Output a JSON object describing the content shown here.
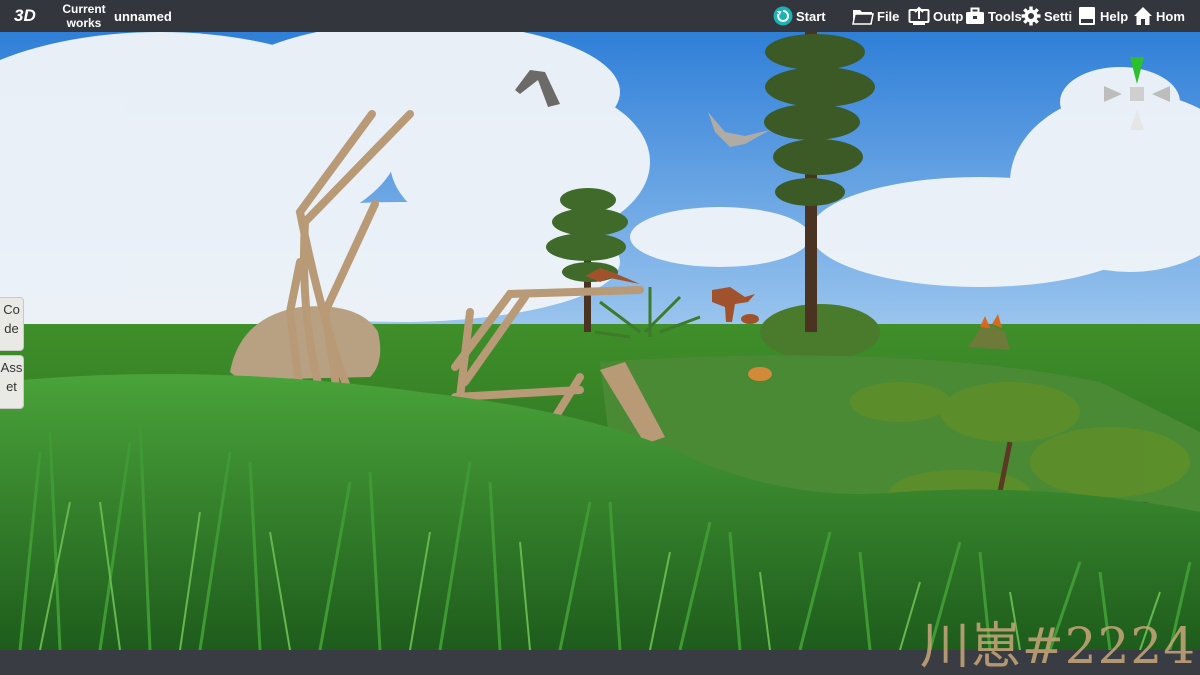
{
  "topbar": {
    "mode_label": "3D",
    "current_works_label": "Current works",
    "project_name": "unnamed",
    "menu": {
      "start": "Start",
      "file": "File",
      "output": "Outp",
      "tools": "Tools",
      "settings": "Setti",
      "help": "Help",
      "home": "Hom"
    }
  },
  "sidebar": {
    "code_tab": "Code",
    "asset_tab": "Asset"
  },
  "watermark": "川崽#2224",
  "colors": {
    "topbar_bg": "#34363d",
    "start_icon": "#19b3b8",
    "sky": "#3d8fe0",
    "grass": "#3f8f2a"
  }
}
